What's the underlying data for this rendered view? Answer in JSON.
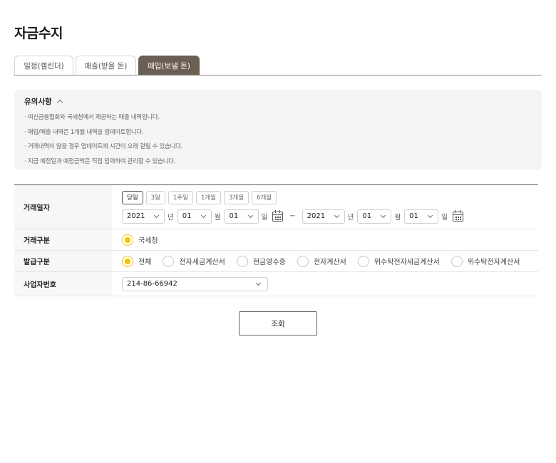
{
  "page_title": "자금수지",
  "tabs": [
    {
      "label": "일정(캘린더)"
    },
    {
      "label": "매출(받을 돈)"
    },
    {
      "label": "매입(보낼 돈)",
      "active": true
    }
  ],
  "notice": {
    "title": "유의사항",
    "items": [
      "여신금융협회와 국세청에서 제공하는 매출 내역입니다.",
      "매입/매출 내역은 1개월 내역을 업데이트합니다.",
      "거래내역이 많을 경우 업데이트에 시간이 오래 걸릴 수 있습니다.",
      "지급 예정일과 예정금액은 직접 입력하여 관리할 수 있습니다."
    ]
  },
  "form": {
    "trade_date": {
      "label": "거래일자",
      "period_buttons": [
        "당일",
        "3일",
        "1주일",
        "1개월",
        "3개월",
        "6개월"
      ],
      "active_period": "당일",
      "from": {
        "year": "2021",
        "month": "01",
        "day": "01"
      },
      "to": {
        "year": "2021",
        "month": "01",
        "day": "01"
      },
      "unit_year": "년",
      "unit_month": "월",
      "unit_day": "일",
      "separator": "~"
    },
    "trade_type": {
      "label": "거래구분",
      "options": [
        "국세청"
      ],
      "selected": "국세청"
    },
    "issue_type": {
      "label": "발급구분",
      "options": [
        "전체",
        "전자세금계산서",
        "현금영수증",
        "전자계산서",
        "위수탁전자세금계산서",
        "위수탁전자계산서"
      ],
      "selected": "전체"
    },
    "business_number": {
      "label": "사업자번호",
      "value": "214-86-66942"
    }
  },
  "search_button": "조회",
  "colors": {
    "active_tab_bg": "#6b5e52",
    "radio_checked": "#f5c400",
    "notice_bg": "#f5f5f5"
  }
}
